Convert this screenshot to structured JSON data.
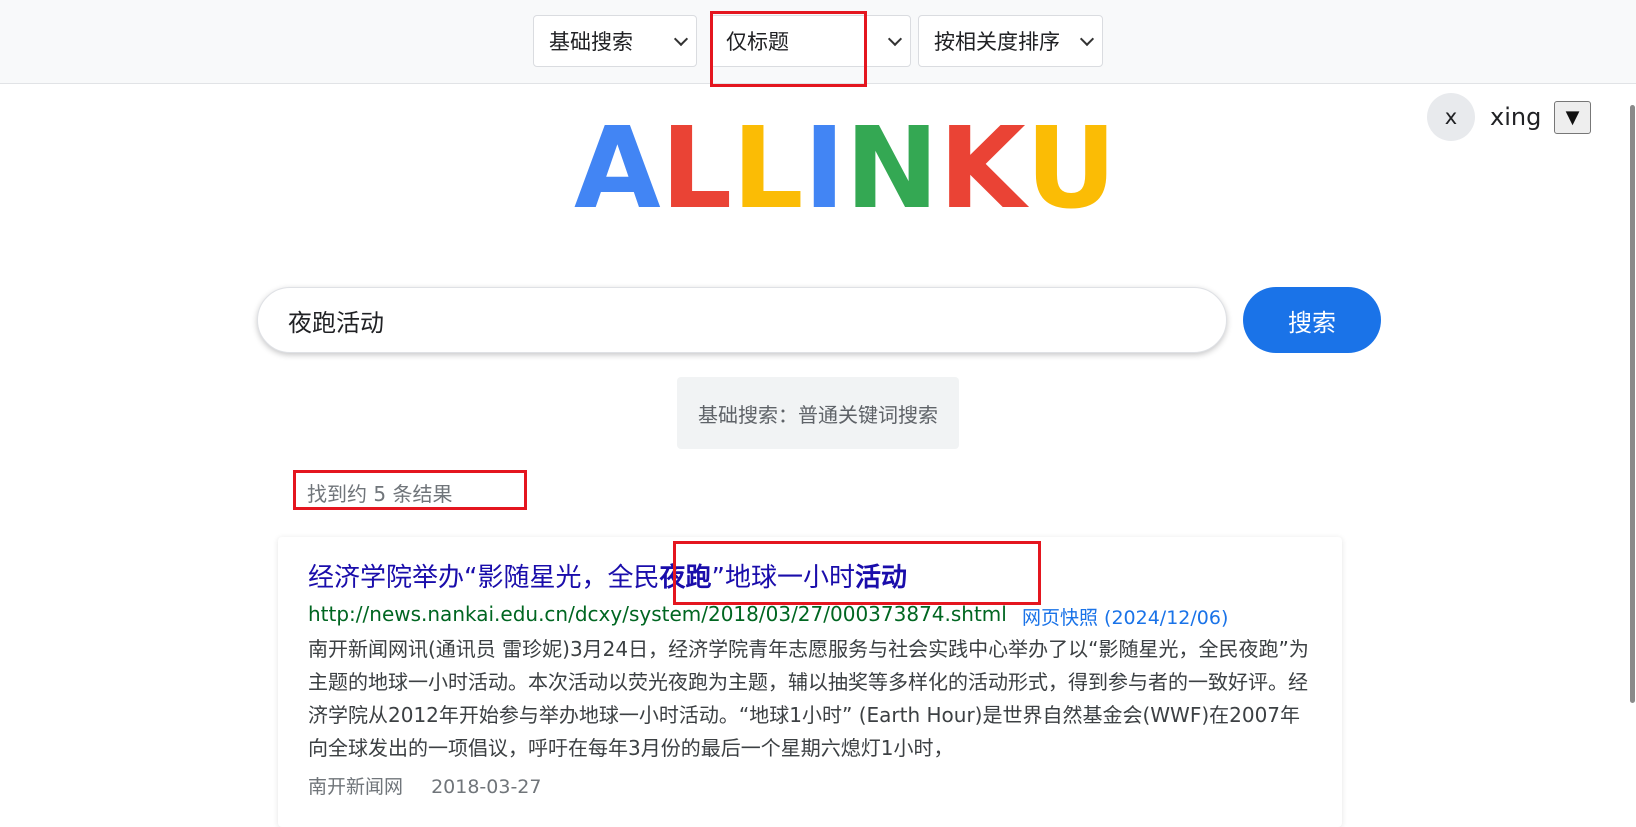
{
  "toolbar": {
    "search_mode": "基础搜索",
    "search_scope": "仅标题",
    "sort_order": "按相关度排序"
  },
  "user": {
    "avatar_initial": "x",
    "name": "xing",
    "menu_toggle": "▼"
  },
  "logo": {
    "letters": [
      {
        "char": "A",
        "color": "#4285f4"
      },
      {
        "char": "L",
        "color": "#ea4335"
      },
      {
        "char": "L",
        "color": "#fbbc05"
      },
      {
        "char": "I",
        "color": "#4285f4"
      },
      {
        "char": "N",
        "color": "#34a853"
      },
      {
        "char": "K",
        "color": "#ea4335"
      },
      {
        "char": "U",
        "color": "#fbbc05"
      }
    ]
  },
  "search": {
    "query": "夜跑活动",
    "button_label": "搜索",
    "mode_hint": "基础搜索：普通关键词搜索"
  },
  "results": {
    "count_text": "找到约 5 条结果",
    "items": [
      {
        "title_parts": [
          {
            "text": "经济学院举办“影随星光，全民",
            "bold": false
          },
          {
            "text": "夜跑",
            "bold": true
          },
          {
            "text": "”地球一小时",
            "bold": false
          },
          {
            "text": "活动",
            "bold": true
          }
        ],
        "url": "http://news.nankai.edu.cn/dcxy/system/2018/03/27/000373874.shtml",
        "cache_label": "网页快照 (2024/12/06)",
        "snippet": "南开新闻网讯(通讯员 雷珍妮)3月24日，经济学院青年志愿服务与社会实践中心举办了以“影随星光，全民夜跑”为主题的地球一小时活动。本次活动以荧光夜跑为主题，辅以抽奖等多样化的活动形式，得到参与者的一致好评。经济学院从2012年开始参与举办地球一小时活动。“地球1小时” (Earth Hour)是世界自然基金会(WWF)在2007年向全球发出的一项倡议，呼吁在每年3月份的最后一个星期六熄灯1小时，",
        "source": "南开新闻网",
        "date": "2018-03-27"
      }
    ]
  }
}
